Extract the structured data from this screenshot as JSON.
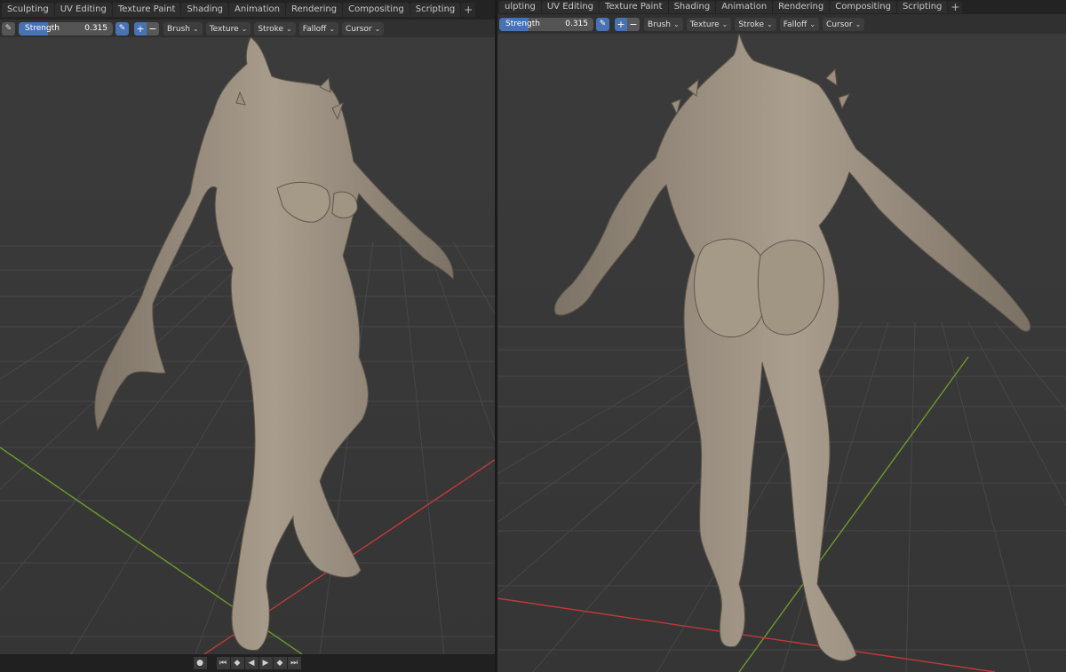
{
  "left": {
    "tabs": [
      "Sculpting",
      "UV Editing",
      "Texture Paint",
      "Shading",
      "Animation",
      "Rendering",
      "Compositing",
      "Scripting"
    ],
    "toolbar": {
      "slider_label": "Strength",
      "slider_value": "0.315",
      "strength_fraction": 0.315,
      "dropdowns": [
        "Brush",
        "Texture",
        "Stroke",
        "Falloff",
        "Cursor"
      ]
    }
  },
  "right": {
    "tabs": [
      "ulpting",
      "UV Editing",
      "Texture Paint",
      "Shading",
      "Animation",
      "Rendering",
      "Compositing",
      "Scripting"
    ],
    "toolbar": {
      "slider_label": "Strength",
      "slider_value": "0.315",
      "strength_fraction": 0.315,
      "dropdowns": [
        "Brush",
        "Texture",
        "Stroke",
        "Falloff",
        "Cursor"
      ]
    }
  },
  "icons": {
    "add_tab": "+",
    "chevron": "⌄",
    "plus": "+",
    "minus": "−",
    "pen": "✎",
    "brush_tool": "✎",
    "record": "●",
    "jump_start": "⏮",
    "key_prev": "◆",
    "play_reverse": "◀",
    "play": "▶",
    "key_next": "◆",
    "jump_end": "⏭"
  },
  "colors": {
    "accent_blue": "#4772b3",
    "x_axis": "#c03a3a",
    "y_axis": "#6e9a2c",
    "grid": "#474747",
    "model": "#9b8f80",
    "viewport_bg": "#3a3a3a"
  }
}
